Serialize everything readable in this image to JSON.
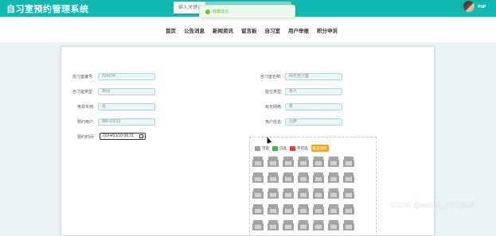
{
  "app_title": "自习室预约管理系统",
  "search": {
    "placeholder": "输入关键词"
  },
  "toast": {
    "text": "收藏成功"
  },
  "user": {
    "name": "PNP"
  },
  "nav": [
    "首页",
    "公告消息",
    "新闻资讯",
    "留言板",
    "自习室",
    "用户举报",
    "积分申诉"
  ],
  "form": {
    "left": [
      {
        "label": "自习室编号:",
        "value": "234234"
      },
      {
        "label": "自习室类型:",
        "value": "单间"
      },
      {
        "label": "电源专用:",
        "value": "否"
      },
      {
        "label": "预约用户:",
        "value": "用8-1/2/13"
      }
    ],
    "right": [
      {
        "label": "自习室名称:",
        "value": "阳光自习室"
      },
      {
        "label": "座位类型:",
        "value": "单人"
      },
      {
        "label": "有无网络:",
        "value": "有"
      },
      {
        "label": "用户姓名:",
        "value": "吕萨"
      }
    ],
    "time": {
      "label": "预约时间:",
      "value": "2024/03/10 08:31"
    }
  },
  "seat_panel": {
    "legend": [
      {
        "label": "可选",
        "color": "#9e9e9e"
      },
      {
        "label": "已选",
        "color": "#4caf50"
      },
      {
        "label": "不可选",
        "color": "#e53935"
      }
    ],
    "reserve_button": "确定预约",
    "seats": {
      "columns": 8,
      "rows": 5,
      "visible": [
        7,
        7,
        7,
        7,
        7
      ],
      "status": "可选"
    }
  },
  "watermark": "CSDN @weixin_ZYKJ985",
  "colors": {
    "brand": "#12b6b0",
    "input_bg": "#e9f7f6",
    "input_border": "#a9dcd8",
    "reserve": "#f5a623"
  }
}
